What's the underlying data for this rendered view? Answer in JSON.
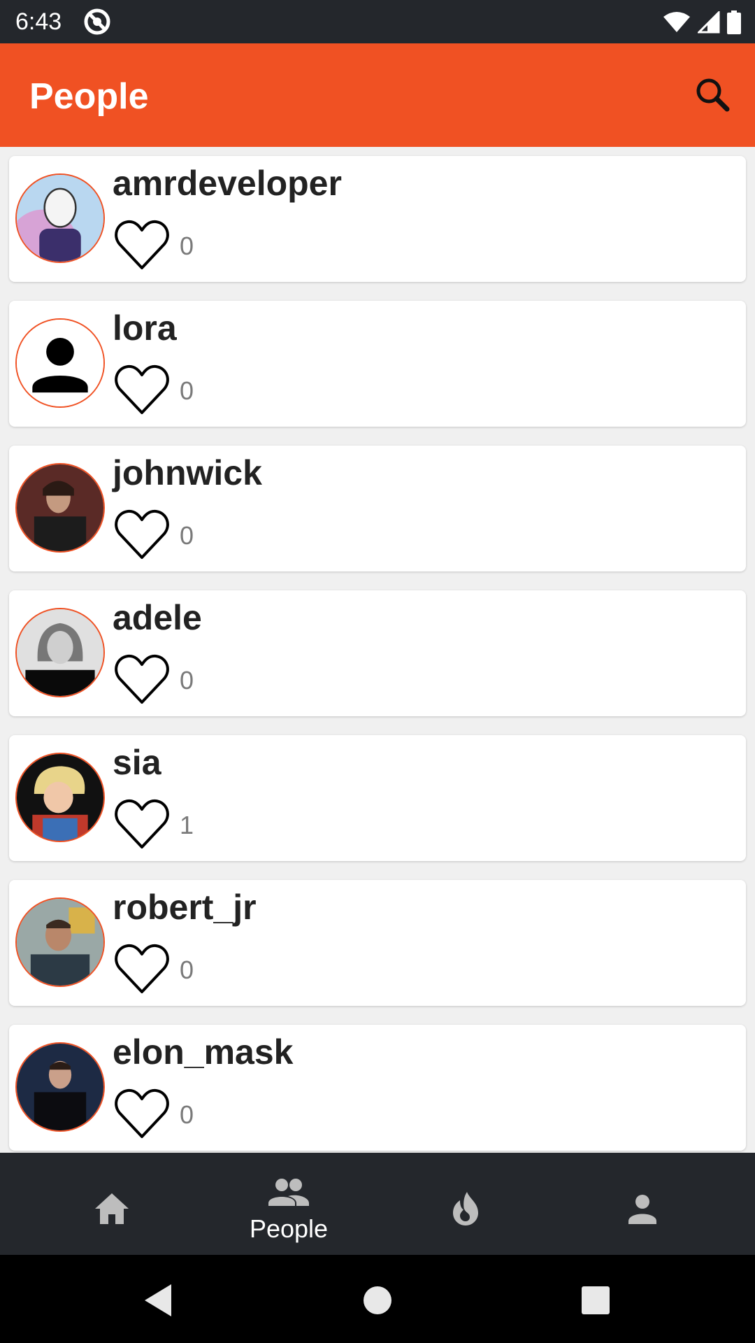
{
  "status_bar": {
    "time": "6:43"
  },
  "app_bar": {
    "title": "People",
    "search_icon": "search-icon"
  },
  "people": [
    {
      "username": "amrdeveloper",
      "likes": "0"
    },
    {
      "username": "lora",
      "likes": "0"
    },
    {
      "username": "johnwick",
      "likes": "0"
    },
    {
      "username": "adele",
      "likes": "0"
    },
    {
      "username": "sia",
      "likes": "1"
    },
    {
      "username": "robert_jr",
      "likes": "0"
    },
    {
      "username": "elon_mask",
      "likes": "0"
    }
  ],
  "bottom_nav": {
    "items": [
      {
        "icon": "home-icon",
        "label": ""
      },
      {
        "icon": "people-icon",
        "label": "People",
        "active": true
      },
      {
        "icon": "fire-icon",
        "label": ""
      },
      {
        "icon": "person-icon",
        "label": ""
      }
    ]
  },
  "colors": {
    "accent": "#f05123",
    "status_bar": "#24272c",
    "bottom_nav": "#24272c",
    "background": "#f0f0f0"
  }
}
